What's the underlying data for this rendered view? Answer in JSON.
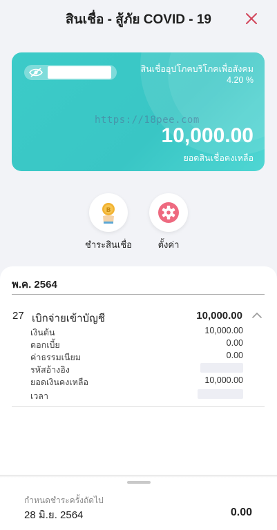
{
  "header": {
    "title": "สินเชื่อ - สู้ภัย COVID - 19"
  },
  "card": {
    "product_name": "สินเชื่ออุปโภคบริโภคเพื่อสังคม",
    "rate": "4.20 %",
    "watermark": "https://18pee.com",
    "amount": "10,000.00",
    "amount_label": "ยอดสินเชื่อคงเหลือ"
  },
  "actions": [
    {
      "label": "ชำระสินเชื่อ",
      "icon": "coin-hand-icon"
    },
    {
      "label": "ตั้งค่า",
      "icon": "gear-icon"
    }
  ],
  "transactions": {
    "year_header": "พ.ค. 2564",
    "items": [
      {
        "day": "27",
        "title": "เบิกจ่ายเข้าบัญชี",
        "amount": "10,000.00",
        "details": [
          {
            "label": "เงินต้น",
            "value": "10,000.00"
          },
          {
            "label": "ดอกเบี้ย",
            "value": "0.00"
          },
          {
            "label": "ค่าธรรมเนียม",
            "value": "0.00"
          },
          {
            "label": "รหัสอ้างอิง",
            "value": ""
          },
          {
            "label": "ยอดเงินคงเหลือ",
            "value": "10,000.00"
          },
          {
            "label": "เวลา",
            "value": ""
          }
        ]
      }
    ]
  },
  "next_payment": {
    "label": "กำหนดชำระครั้งถัดไป",
    "date": "28 มิ.ย. 2564",
    "amount": "0.00"
  },
  "colors": {
    "card": "#3ccbc8",
    "close": "#d2455a",
    "settings": "#ee6a80",
    "coin": "#f2b230"
  }
}
